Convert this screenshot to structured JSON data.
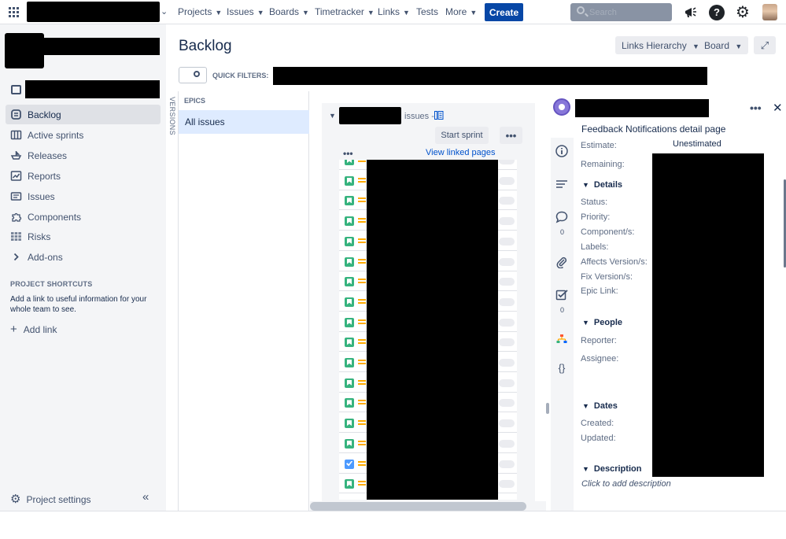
{
  "topnav": {
    "menu": [
      {
        "label": "Projects",
        "caret": true
      },
      {
        "label": "Issues",
        "caret": true
      },
      {
        "label": "Boards",
        "caret": true
      },
      {
        "label": "Timetracker",
        "caret": true
      },
      {
        "label": "Links",
        "caret": true
      },
      {
        "label": "Tests",
        "caret": false
      },
      {
        "label": "More",
        "caret": true
      }
    ],
    "create_label": "Create",
    "search_placeholder": "Search"
  },
  "sidebar": {
    "items": [
      {
        "label": "Backlog",
        "icon": "backlog-icon",
        "active": true
      },
      {
        "label": "Active sprints",
        "icon": "board-columns-icon",
        "active": false
      },
      {
        "label": "Releases",
        "icon": "ship-icon",
        "active": false
      },
      {
        "label": "Reports",
        "icon": "chart-icon",
        "active": false
      },
      {
        "label": "Issues",
        "icon": "issues-icon",
        "active": false
      },
      {
        "label": "Components",
        "icon": "puzzle-icon",
        "active": false
      },
      {
        "label": "Risks",
        "icon": "grid-icon",
        "active": false
      },
      {
        "label": "Add-ons",
        "icon": "chevron-right-icon",
        "active": false
      }
    ],
    "shortcuts_heading": "PROJECT SHORTCUTS",
    "shortcuts_text": "Add a link to useful information for your whole team to see.",
    "add_link_label": "Add link",
    "project_settings_label": "Project settings"
  },
  "header": {
    "title": "Backlog",
    "links_hierarchy_label": "Links Hierarchy",
    "board_label": "Board",
    "quick_filters_label": "QUICK FILTERS:"
  },
  "epics": {
    "versions_label": "VERSIONS",
    "heading": "EPICS",
    "all_issues_label": "All issues"
  },
  "sprint": {
    "issues_label": "issues -",
    "start_sprint_label": "Start sprint",
    "more_label": "•••",
    "view_linked_label": "View linked pages",
    "issue_types": [
      "story",
      "story",
      "story",
      "story",
      "story",
      "story",
      "story",
      "story",
      "story",
      "story",
      "story",
      "story",
      "story",
      "story",
      "story",
      "task",
      "story",
      "story"
    ]
  },
  "detail": {
    "title": "Feedback Notifications detail page",
    "estimate_label": "Estimate:",
    "estimate_value": "Unestimated",
    "remaining_label": "Remaining:",
    "details_heading": "Details",
    "details_fields": [
      "Status:",
      "Priority:",
      "Component/s:",
      "Labels:",
      "Affects Version/s:",
      "Fix Version/s:",
      "Epic Link:"
    ],
    "people_heading": "People",
    "people_fields": [
      "Reporter:",
      "Assignee:"
    ],
    "dates_heading": "Dates",
    "dates_fields": [
      "Created:",
      "Updated:"
    ],
    "description_heading": "Description",
    "description_placeholder": "Click to add description",
    "comments_count": "0",
    "checklist_count": "0"
  }
}
